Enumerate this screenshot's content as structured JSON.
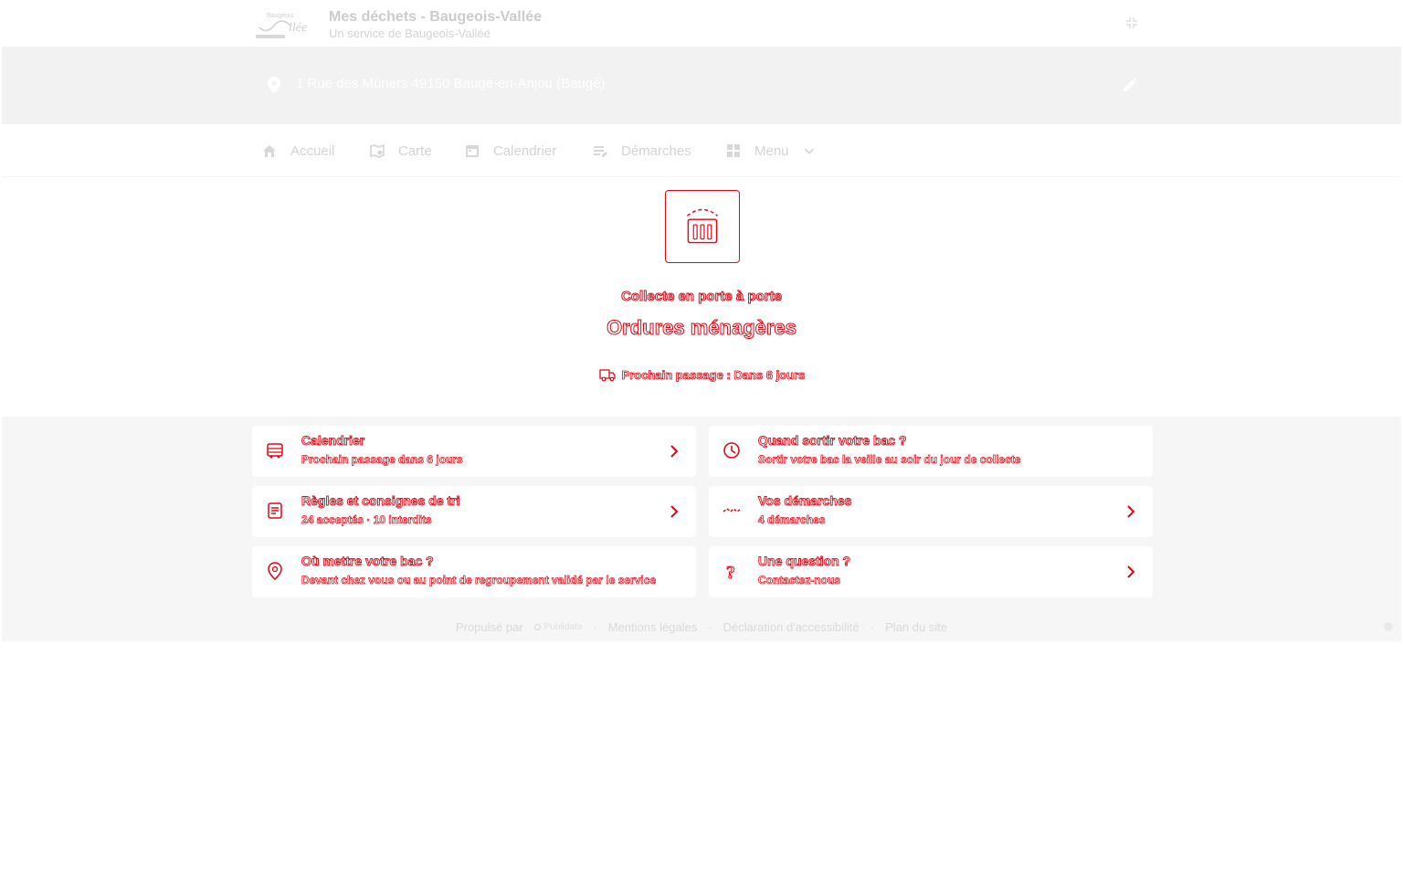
{
  "header": {
    "logo_text": "Baugeois Vallée",
    "title": "Mes déchets - Baugeois-Vallée",
    "subtitle": "Un service de Baugeois-Vallée",
    "collapse_icon": "fullscreen-exit-icon"
  },
  "address": {
    "icon": "map-pin-icon",
    "value": "1 Rue des Mûriers 49150 Baugé-en-Anjou (Baugé)",
    "edit_icon": "pencil-icon"
  },
  "nav": {
    "items": [
      {
        "label": "Accueil",
        "icon": "home-icon"
      },
      {
        "label": "Carte",
        "icon": "map-icon"
      },
      {
        "label": "Calendrier",
        "icon": "calendar-icon"
      },
      {
        "label": "Démarches",
        "icon": "forms-icon"
      },
      {
        "label": "Menu",
        "icon": "grid-icon"
      }
    ]
  },
  "hero": {
    "icon": "trash-bin-icon",
    "supertitle": "Collecte en porte à porte",
    "title": "Ordures ménagères",
    "next_pass": "Prochain passage : Dans 6 jours",
    "next_pass_icon": "truck-icon"
  },
  "cards": [
    {
      "title": "Calendrier",
      "subtitle": "Prochain passage dans 6 jours",
      "icon": "bus-calendar-icon"
    },
    {
      "title": "Quand sortir votre bac ?",
      "subtitle": "Sortir votre bac la veille au soir du jour de collecte",
      "icon": "clock-icon"
    },
    {
      "title": "Règles et consignes de tri",
      "subtitle": "24 acceptés  ·  10 interdits",
      "icon": "rules-icon"
    },
    {
      "title": "Vos démarches",
      "subtitle": "4 démarches",
      "icon": "handshake-icon"
    },
    {
      "title": "Où mettre votre bac ?",
      "subtitle": "Devant chez vous ou au point de regroupement validé par le service",
      "icon": "location-icon"
    },
    {
      "title": "Une question ?",
      "subtitle": "Contactez-nous",
      "icon": "question-icon"
    }
  ],
  "footer": {
    "powered_by": "Propulsé par",
    "brand": "Publidata",
    "links": [
      "Mentions légales",
      "Déclaration d'accessibilité",
      "Plan du site"
    ]
  },
  "colors": {
    "accent": "#e30613",
    "muted": "#d4d4d4",
    "band": "#f2f2f2"
  }
}
